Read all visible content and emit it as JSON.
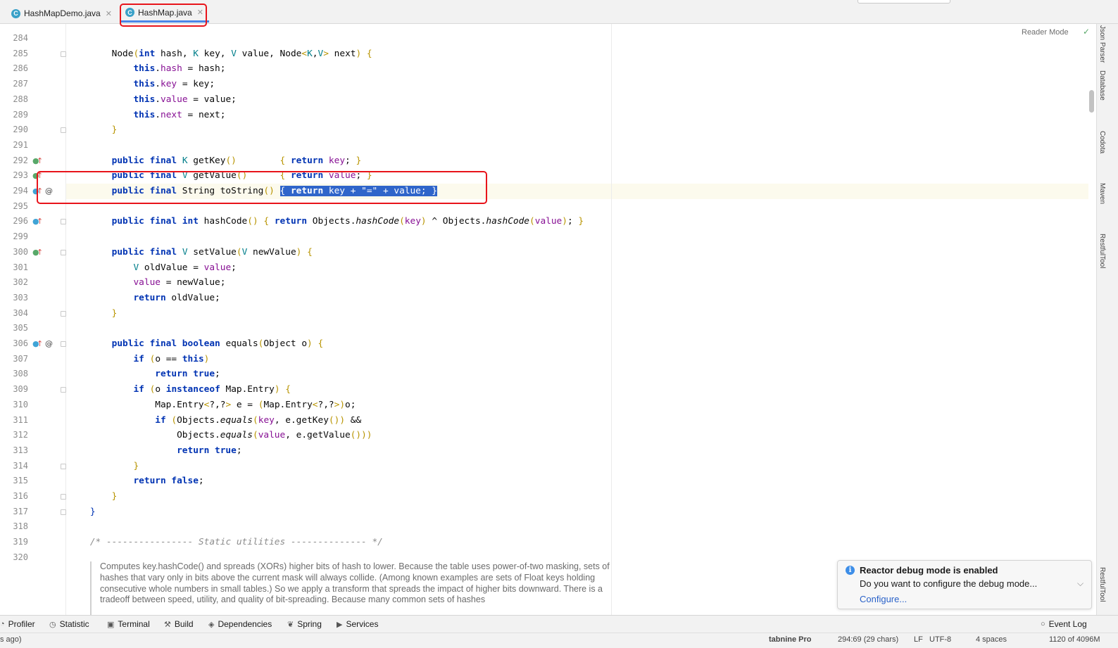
{
  "tabs": [
    {
      "label": "HashMapDemo.java",
      "icon": "java-class-icon",
      "active": false
    },
    {
      "label": "HashMap.java",
      "icon": "java-class-lock-icon",
      "active": true
    }
  ],
  "editor": {
    "reader_mode": "Reader Mode",
    "lines": [
      {
        "n": "284",
        "html": ""
      },
      {
        "n": "285",
        "html": "    Node<span class='br'>(</span><span class='kw'>int</span> hash, <span class='tp'>K</span> key, <span class='tp'>V</span> value, Node<span class='br'>&lt;</span><span class='tp'>K</span>,<span class='tp'>V</span><span class='br'>&gt;</span> next<span class='br'>)</span> <span class='br'>{</span>"
      },
      {
        "n": "286",
        "html": "        <span class='kw'>this</span>.<span class='fld'>hash</span> = hash;"
      },
      {
        "n": "287",
        "html": "        <span class='kw'>this</span>.<span class='fld'>key</span> = key;"
      },
      {
        "n": "288",
        "html": "        <span class='kw'>this</span>.<span class='fld'>value</span> = value;"
      },
      {
        "n": "289",
        "html": "        <span class='kw'>this</span>.<span class='fld'>next</span> = next;"
      },
      {
        "n": "290",
        "html": "    <span class='br'>}</span>"
      },
      {
        "n": "291",
        "html": ""
      },
      {
        "n": "292",
        "html": "    <span class='kw'>public final</span> <span class='tp'>K</span> getKey<span class='br'>()</span>        <span class='br'>{</span> <span class='kw'>return</span> <span class='fld'>key</span>; <span class='br'>}</span>"
      },
      {
        "n": "293",
        "html": "    <span class='kw'>public final</span> <span class='tp'>V</span> getValue<span class='br'>()</span>      <span class='br'>{</span> <span class='kw'>return</span> <span class='fld'>value</span>; <span class='br'>}</span>"
      },
      {
        "n": "294",
        "html": "    <span class='kw'>public final</span> String toString<span class='br'>()</span> <span class='sel'>{ <span class='kw'>return</span> <span class='fld'>key</span> + \"=\" + <span class='fld'>value</span>; }</span>"
      },
      {
        "n": "295",
        "html": ""
      },
      {
        "n": "296",
        "html": "    <span class='kw'>public final int</span> hashCode<span class='br'>()</span> <span class='br'>{</span> <span class='kw'>return</span> Objects.<span class='it'>hashCode</span><span class='br'>(</span><span class='fld'>key</span><span class='br'>)</span> ^ Objects.<span class='it'>hashCode</span><span class='br'>(</span><span class='fld'>value</span><span class='br'>)</span>; <span class='br'>}</span>"
      },
      {
        "n": "299",
        "html": ""
      },
      {
        "n": "300",
        "html": "    <span class='kw'>public final</span> <span class='tp'>V</span> setValue<span class='br'>(</span><span class='tp'>V</span> newValue<span class='br'>)</span> <span class='br'>{</span>"
      },
      {
        "n": "301",
        "html": "        <span class='tp'>V</span> oldValue = <span class='fld'>value</span>;"
      },
      {
        "n": "302",
        "html": "        <span class='fld'>value</span> = newValue;"
      },
      {
        "n": "303",
        "html": "        <span class='kw'>return</span> oldValue;"
      },
      {
        "n": "304",
        "html": "    <span class='br'>}</span>"
      },
      {
        "n": "305",
        "html": ""
      },
      {
        "n": "306",
        "html": "    <span class='kw'>public final boolean</span> equals<span class='br'>(</span>Object o<span class='br'>)</span> <span class='br'>{</span>"
      },
      {
        "n": "307",
        "html": "        <span class='kw'>if</span> <span class='br'>(</span>o == <span class='kw'>this</span><span class='br'>)</span>"
      },
      {
        "n": "308",
        "html": "            <span class='kw'>return true</span>;"
      },
      {
        "n": "309",
        "html": "        <span class='kw'>if</span> <span class='br'>(</span>o <span class='kw'>instanceof</span> Map.Entry<span class='br'>)</span> <span class='br'>{</span>"
      },
      {
        "n": "310",
        "html": "            Map.Entry<span class='br'>&lt;</span>?,?<span class='br'>&gt;</span> e = <span class='br'>(</span>Map.Entry<span class='br'>&lt;</span>?,?<span class='br'>&gt;)</span>o;"
      },
      {
        "n": "311",
        "html": "            <span class='kw'>if</span> <span class='br'>(</span>Objects.<span class='it'>equals</span><span class='br'>(</span><span class='fld'>key</span>, e.getKey<span class='br'>())</span> &amp;&amp;"
      },
      {
        "n": "312",
        "html": "                Objects.<span class='it'>equals</span><span class='br'>(</span><span class='fld'>value</span>, e.getValue<span class='br'>()))</span>"
      },
      {
        "n": "313",
        "html": "                <span class='kw'>return true</span>;"
      },
      {
        "n": "314",
        "html": "        <span class='br'>}</span>"
      },
      {
        "n": "315",
        "html": "        <span class='kw'>return false</span>;"
      },
      {
        "n": "316",
        "html": "    <span class='br'>}</span>"
      },
      {
        "n": "317",
        "html": "<span style='color:#0033b3'>}</span>"
      },
      {
        "n": "318",
        "html": ""
      },
      {
        "n": "319",
        "html": "<span class='cm'>/* ---------------- Static utilities -------------- */</span>"
      },
      {
        "n": "320",
        "html": ""
      }
    ],
    "doc_comment": "Computes key.hashCode() and spreads (XORs) higher bits of hash to lower. Because the table uses power-of-two masking, sets of hashes that vary only in bits above the current mask will always collide. (Among known examples are sets of Float keys holding consecutive whole numbers in small tables.) So we apply a transform that spreads the impact of higher bits downward. There is a tradeoff between speed, utility, and quality of bit-spreading. Because many common sets of hashes"
  },
  "right_panels": [
    "Json Parser",
    "Database",
    "Codota",
    "Maven",
    "RestfulTool"
  ],
  "notification": {
    "title": "Reactor debug mode is enabled",
    "message": "Do you want to configure the debug mode...",
    "link": "Configure..."
  },
  "toolbar": {
    "items": [
      {
        "label": "Profiler",
        "icon": "profiler-icon"
      },
      {
        "label": "Statistic",
        "icon": "statistic-icon"
      },
      {
        "label": "Terminal",
        "icon": "terminal-icon"
      },
      {
        "label": "Build",
        "icon": "hammer-icon"
      },
      {
        "label": "Dependencies",
        "icon": "dependencies-icon"
      },
      {
        "label": "Spring",
        "icon": "spring-leaf-icon"
      },
      {
        "label": "Services",
        "icon": "services-icon"
      }
    ],
    "event_log": "Event Log"
  },
  "status": {
    "left": "s ago)",
    "tabnine": "tabnine Pro",
    "position": "294:69 (29 chars)",
    "line_sep": "LF",
    "encoding": "UTF-8",
    "indent": "4 spaces",
    "memory": "1120 of 4096M"
  },
  "colors": {
    "selection": "#2f65ca",
    "highlight_box": "#e8141b",
    "keyword": "#0033b3",
    "field": "#871094"
  }
}
